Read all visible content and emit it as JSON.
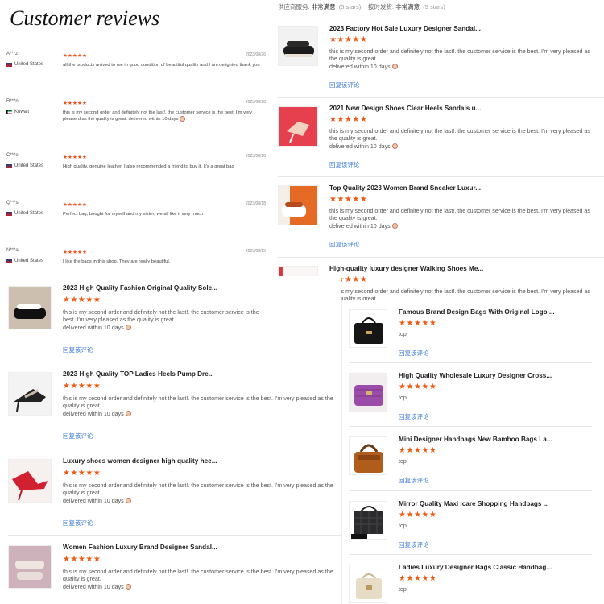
{
  "title": "Customer reviews",
  "header": {
    "item1_label": "供应商服务:",
    "item1_value": "非常满意",
    "item1_stars": "(5 stars)",
    "item2_label": "按时发货:",
    "item2_value": "非常满意",
    "item2_stars": "(5 stars)"
  },
  "reviews": [
    {
      "name": "A***z",
      "country": "United States",
      "stars": "★★★★★",
      "date": "2023/08/26",
      "text": "all the products arrived to me in good condition of beautiful quality and I am delighted thank you"
    },
    {
      "name": "R***n",
      "country": "Kuwait",
      "stars": "★★★★★",
      "date": "2023/08/18",
      "text": "this is my second order and definitely not the last!. the customer service is the best. I'm very please d as the quality is great. delivered within 10 days"
    },
    {
      "name": "C***e",
      "country": "United States",
      "stars": "★★★★★",
      "date": "2023/08/18",
      "text": "High quality, genuine leather. I also recommended a friend to buy it. It's a great bag"
    },
    {
      "name": "Q***s",
      "country": "United States",
      "stars": "★★★★★",
      "date": "2023/08/18",
      "text": "Perfect bag, bought for myself and my sister, we all like it very much"
    },
    {
      "name": "N***a",
      "country": "United States",
      "stars": "★★★★★",
      "date": "2023/08/15",
      "text": "I like the bags in this shop. They are really beautiful."
    }
  ],
  "left_cards": [
    {
      "name": "2023 High Quality Fashion Original Quality Sole...",
      "stars": "★★★★★",
      "text": "this is my second order and definitely not the last!. the customer service is the best. I'm very pleased as the quality is great.",
      "delivery": "delivered within 10 days",
      "link": "回复该评论"
    },
    {
      "name": "2023 High Quality TOP Ladies Heels Pump Dre...",
      "stars": "★★★★★",
      "text": "this is my second order and definitely not the last!. the customer service is the best. I'm very pleased as the quality is great.",
      "delivery": "delivered within 10 days",
      "link": "回复该评论"
    },
    {
      "name": "Luxury shoes women designer high quality hee...",
      "stars": "★★★★★",
      "text": "this is my second order and definitely not the last!. the customer service is the best. I'm very pleased as the quality is great.",
      "delivery": "delivered within 10 days",
      "link": "回复该评论"
    },
    {
      "name": "Women Fashion Luxury Brand Designer Sandal...",
      "stars": "★★★★★",
      "text": "this is my second order and definitely not the last!. the customer service is the best. I'm very pleased as the quality is great.",
      "delivery": "delivered within 10 days",
      "link": ""
    }
  ],
  "right_cards": [
    {
      "name": "2023 Factory Hot Sale Luxury Designer Sandal...",
      "stars": "★★★★★",
      "text": "this is my second order and definitely not the last!. the customer service is the best. I'm very pleased as the quality is great.",
      "delivery": "delivered within 10 days",
      "link": "回复该评论"
    },
    {
      "name": "2021 New Design Shoes Clear Heels Sandals u...",
      "stars": "★★★★★",
      "text": "this is my second order and definitely not the last!. the customer service is the best. I'm very pleased as the quality is great.",
      "delivery": "delivered within 10 days",
      "link": "回复该评论"
    },
    {
      "name": "Top Quality 2023 Women Brand Sneaker Luxur...",
      "stars": "★★★★★",
      "text": "this is my second order and definitely not the last!. the customer service is the best. I'm very pleased as the quality is great.",
      "delivery": "delivered within 10 days",
      "link": "回复该评论"
    },
    {
      "name": "High-quality luxury designer Walking Shoes Me...",
      "stars": "★★★★★",
      "text": "this is my second order and definitely not the last!. the customer service is the best. I'm very pleased as the quality is great.",
      "delivery": "",
      "link": ""
    }
  ],
  "bag_cards": [
    {
      "name": "Famous Brand Design Bags With Original Logo ...",
      "stars": "★★★★★",
      "text": "top",
      "link": "回复该评论"
    },
    {
      "name": "High Quality Wholesale Luxury Designer Cross...",
      "stars": "★★★★★",
      "text": "top",
      "link": "回复该评论"
    },
    {
      "name": "Mini Designer Handbags New Bamboo Bags La...",
      "stars": "★★★★★",
      "text": "top",
      "link": "回复该评论"
    },
    {
      "name": "Mirror Quality Maxi Icare Shopping Handbags ...",
      "stars": "★★★★★",
      "text": "top",
      "link": "回复该评论"
    },
    {
      "name": "Ladies Luxury Designer Bags Classic Handbag...",
      "stars": "★★★★★",
      "text": "top",
      "link": ""
    }
  ],
  "colors": {
    "stars": "#ee5a13",
    "link": "#3b7ad8"
  }
}
